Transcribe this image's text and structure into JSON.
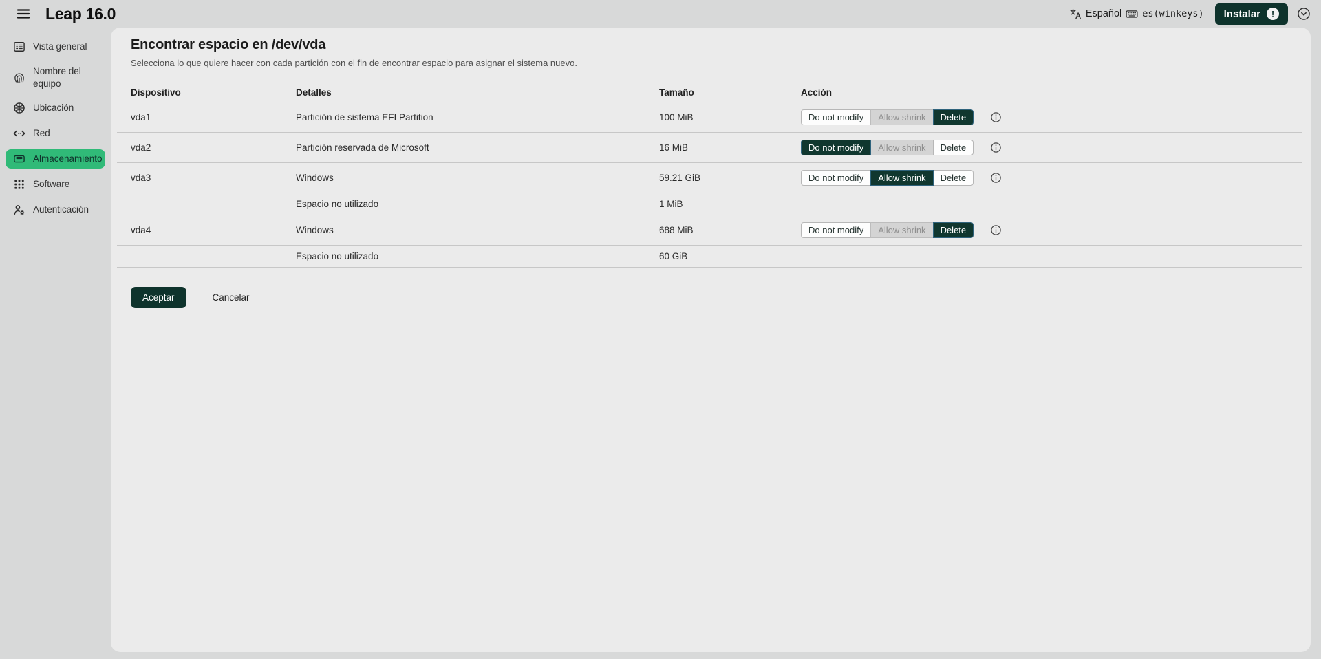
{
  "topbar": {
    "title": "Leap 16.0",
    "language_label": "Español",
    "keyboard_label": "es(winkeys)",
    "install_label": "Instalar",
    "install_badge": "!"
  },
  "sidebar": {
    "items": [
      {
        "label": "Vista general",
        "icon": "overview-icon",
        "selected": false
      },
      {
        "label": "Nombre del equipo",
        "icon": "hostname-icon",
        "selected": false
      },
      {
        "label": "Ubicación",
        "icon": "location-icon",
        "selected": false
      },
      {
        "label": "Red",
        "icon": "network-icon",
        "selected": false
      },
      {
        "label": "Almacenamiento",
        "icon": "storage-icon",
        "selected": true
      },
      {
        "label": "Software",
        "icon": "software-icon",
        "selected": false
      },
      {
        "label": "Autenticación",
        "icon": "authentication-icon",
        "selected": false
      }
    ]
  },
  "main": {
    "title": "Encontrar espacio en /dev/vda",
    "subtitle": "Selecciona lo que quiere hacer con cada partición con el fin de encontrar espacio para asignar el sistema nuevo.",
    "table": {
      "headers": [
        "Dispositivo",
        "Detalles",
        "Tamaño",
        "Acción"
      ],
      "rows": [
        {
          "device": "vda1",
          "details": "Partición de sistema EFI Partition",
          "size": "100 MiB",
          "actions": [
            {
              "label": "Do not modify",
              "state": "normal"
            },
            {
              "label": "Allow shrink",
              "state": "disabled"
            },
            {
              "label": "Delete",
              "state": "selected"
            }
          ],
          "info_icon": true
        },
        {
          "device": "vda2",
          "details": "Partición reservada de Microsoft",
          "size": "16 MiB",
          "actions": [
            {
              "label": "Do not modify",
              "state": "selected"
            },
            {
              "label": "Allow shrink",
              "state": "disabled"
            },
            {
              "label": "Delete",
              "state": "normal"
            }
          ],
          "info_icon": true
        },
        {
          "device": "vda3",
          "details": "Windows",
          "size": "59.21 GiB",
          "actions": [
            {
              "label": "Do not modify",
              "state": "normal"
            },
            {
              "label": "Allow shrink",
              "state": "selected"
            },
            {
              "label": "Delete",
              "state": "normal"
            }
          ],
          "info_icon": true
        },
        {
          "device": "",
          "details": "Espacio no utilizado",
          "size": "1 MiB",
          "actions": null,
          "info_icon": false
        },
        {
          "device": "vda4",
          "details": "Windows",
          "size": "688 MiB",
          "actions": [
            {
              "label": "Do not modify",
              "state": "normal"
            },
            {
              "label": "Allow shrink",
              "state": "disabled"
            },
            {
              "label": "Delete",
              "state": "selected"
            }
          ],
          "info_icon": true
        },
        {
          "device": "",
          "details": "Espacio no utilizado",
          "size": "60 GiB",
          "actions": null,
          "info_icon": false
        }
      ]
    },
    "accept_label": "Aceptar",
    "cancel_label": "Cancelar"
  },
  "colors": {
    "accent_green": "#30ba78",
    "dark_teal": "#0e332c",
    "selected_segment": "#10372f",
    "page_bg": "#d8d9d9",
    "panel_bg": "#ebebeb"
  }
}
